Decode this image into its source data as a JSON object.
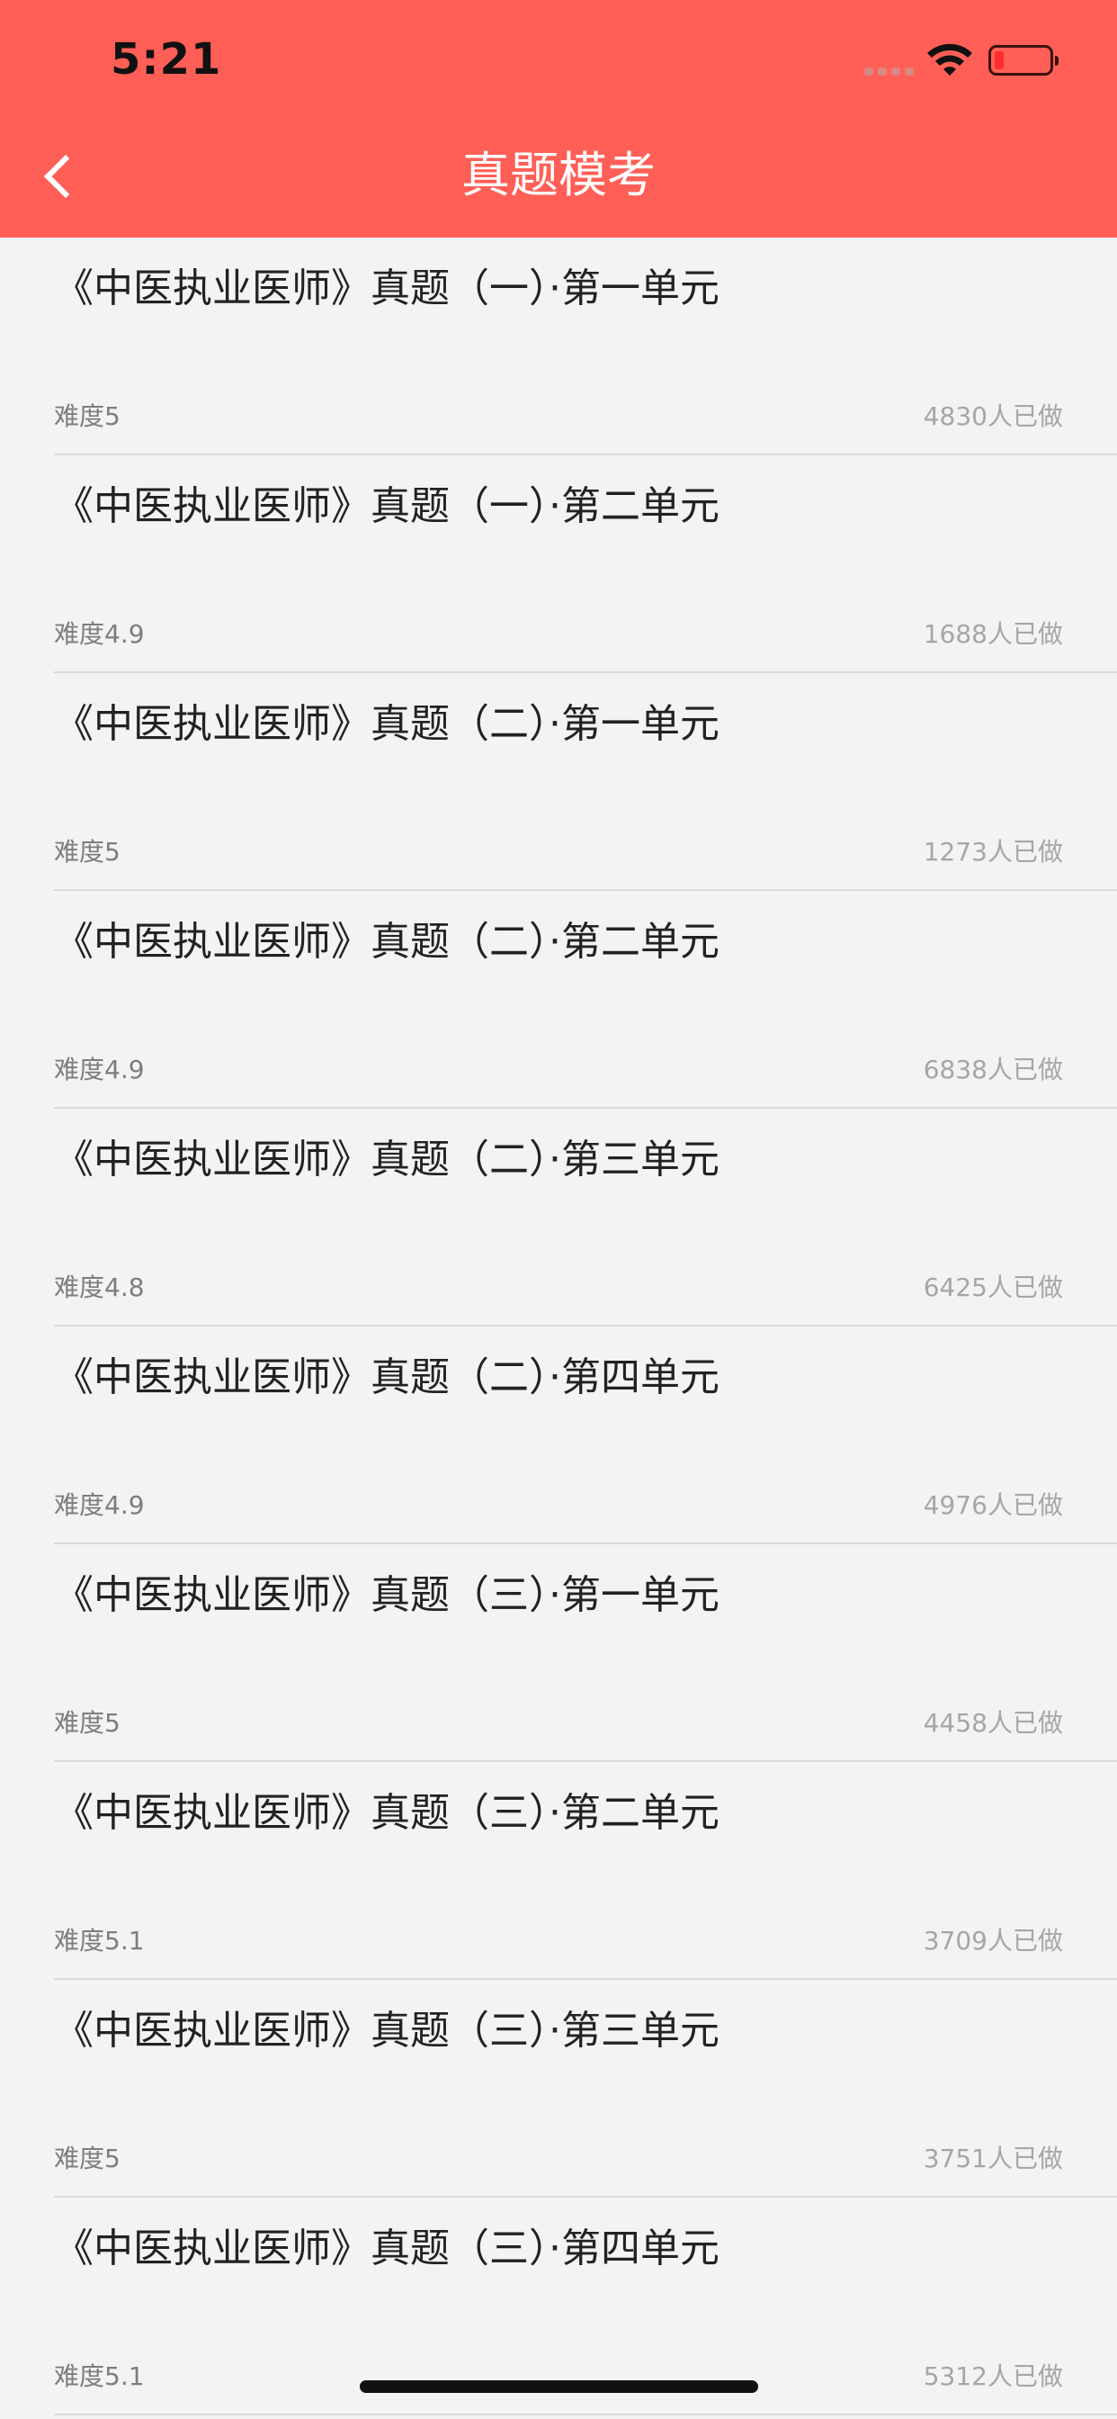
{
  "status_bar": {
    "time": "5:21"
  },
  "header": {
    "title": "真题模考",
    "background": "#ff5f56"
  },
  "items": [
    {
      "title": "《中医执业医师》真题（一）·第一单元",
      "difficulty": "难度5",
      "count": "4830人已做"
    },
    {
      "title": "《中医执业医师》真题（一）·第二单元",
      "difficulty": "难度4.9",
      "count": "1688人已做"
    },
    {
      "title": "《中医执业医师》真题（二）·第一单元",
      "difficulty": "难度5",
      "count": "1273人已做"
    },
    {
      "title": "《中医执业医师》真题（二）·第二单元",
      "difficulty": "难度4.9",
      "count": "6838人已做"
    },
    {
      "title": "《中医执业医师》真题（二）·第三单元",
      "difficulty": "难度4.8",
      "count": "6425人已做"
    },
    {
      "title": "《中医执业医师》真题（二）·第四单元",
      "difficulty": "难度4.9",
      "count": "4976人已做"
    },
    {
      "title": "《中医执业医师》真题（三）·第一单元",
      "difficulty": "难度5",
      "count": "4458人已做"
    },
    {
      "title": "《中医执业医师》真题（三）·第二单元",
      "difficulty": "难度5.1",
      "count": "3709人已做"
    },
    {
      "title": "《中医执业医师》真题（三）·第三单元",
      "difficulty": "难度5",
      "count": "3751人已做"
    },
    {
      "title": "《中医执业医师》真题（三）·第四单元",
      "difficulty": "难度5.1",
      "count": "5312人已做"
    }
  ],
  "icons": {
    "back": "chevron-left-icon",
    "wifi": "wifi-icon",
    "battery": "battery-icon",
    "signal": "signal-icon"
  }
}
